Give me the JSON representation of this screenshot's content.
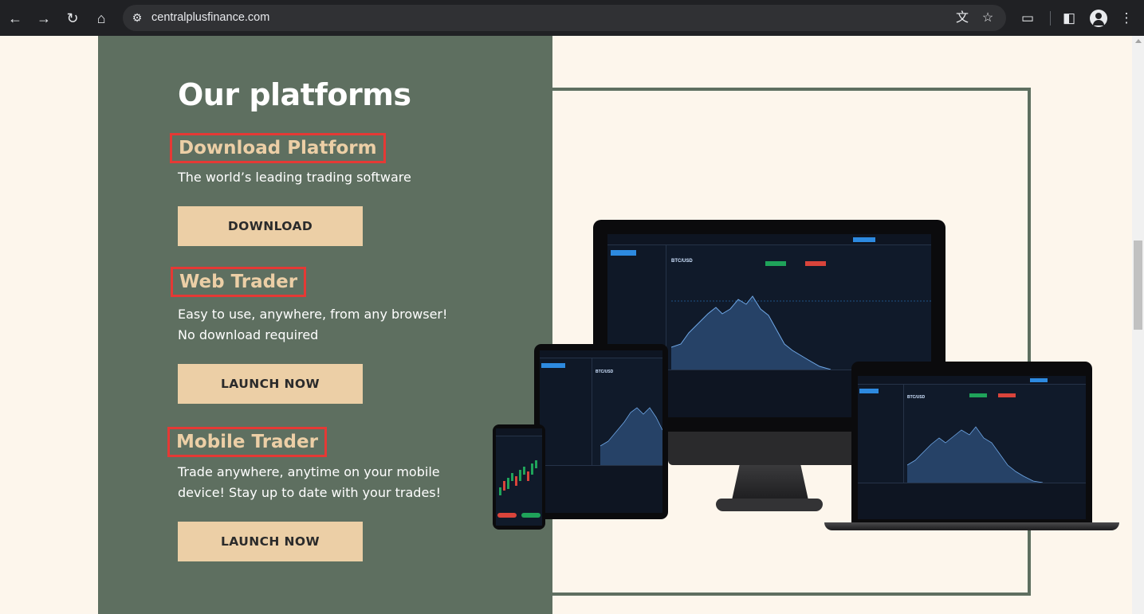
{
  "browser": {
    "url": "centralplusfinance.com",
    "icons": {
      "back": "arrow-left-icon",
      "forward": "arrow-right-icon",
      "reload": "reload-icon",
      "home": "home-icon",
      "site_info": "tune-icon",
      "translate": "translate-icon",
      "bookmark": "star-icon",
      "extensions": "puzzle-icon",
      "side_panel": "side-panel-icon",
      "profile": "profile-icon",
      "menu": "more-vertical-icon"
    }
  },
  "page": {
    "title": "Our platforms",
    "sections": [
      {
        "title": "Download Platform",
        "description_lines": [
          "The world’s leading trading software"
        ],
        "button": "DOWNLOAD"
      },
      {
        "title": "Web Trader",
        "description_lines": [
          "Easy to use, anywhere, from any browser!",
          "No download required"
        ],
        "button": "LAUNCH NOW"
      },
      {
        "title": "Mobile Trader",
        "description_lines": [
          "Trade anywhere, anytime on your mobile",
          "device! Stay up to date with your trades!"
        ],
        "button": "LAUNCH NOW"
      }
    ]
  },
  "devices": {
    "pair_label": "BTC/USD"
  },
  "colors": {
    "page_background": "#fdf6ec",
    "panel": "#5e6f60",
    "accent": "#eccfa6",
    "highlight_border": "#e53935",
    "chrome": "#202124"
  }
}
